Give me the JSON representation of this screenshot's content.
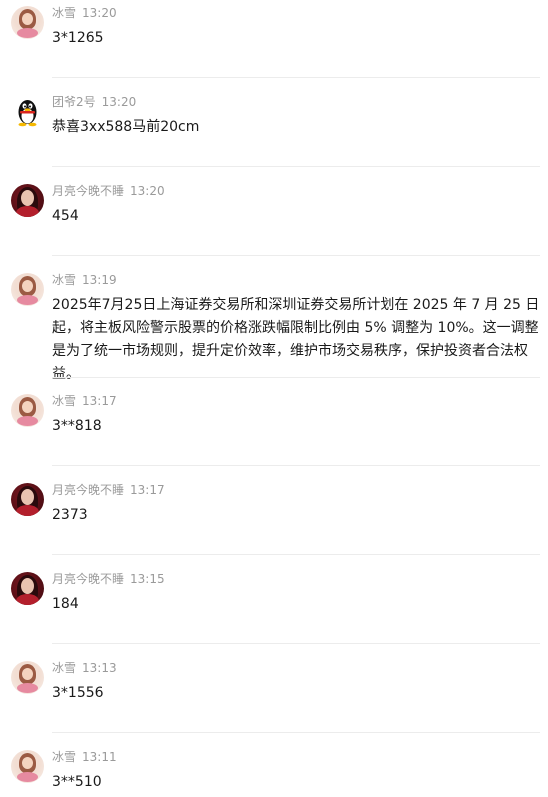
{
  "messages": [
    {
      "sender": "冰雪",
      "time": "13:20",
      "text": "3*1265",
      "avatar": "bingxue-avatar"
    },
    {
      "sender": "团爷2号",
      "time": "13:20",
      "text": "恭喜3xx588马前20cm",
      "avatar": "qq-penguin-avatar"
    },
    {
      "sender": "月亮今晚不睡",
      "time": "13:20",
      "text": "454",
      "avatar": "yueliang-avatar"
    },
    {
      "sender": "冰雪",
      "time": "13:19",
      "text": "2025年7月25日上海证券交易所和深圳证券交易所计划在 2025 年 7 月 25 日起，将主板风险警示股票的价格涨跌幅限制比例由 5% 调整为 10%。这一调整是为了统一市场规则，提升定价效率，维护市场交易秩序，保护投资者合法权益。",
      "avatar": "bingxue-avatar"
    },
    {
      "sender": "冰雪",
      "time": "13:17",
      "text": "3**818",
      "avatar": "bingxue-avatar"
    },
    {
      "sender": "月亮今晚不睡",
      "time": "13:17",
      "text": "2373",
      "avatar": "yueliang-avatar"
    },
    {
      "sender": "月亮今晚不睡",
      "time": "13:15",
      "text": "184",
      "avatar": "yueliang-avatar"
    },
    {
      "sender": "冰雪",
      "time": "13:13",
      "text": "3*1556",
      "avatar": "bingxue-avatar"
    },
    {
      "sender": "冰雪",
      "time": "13:11",
      "text": "3**510",
      "avatar": "bingxue-avatar"
    }
  ],
  "colors": {
    "meta_text": "#9a9a9a",
    "body_text": "#1a1a1a",
    "divider": "#ececec",
    "background": "#ffffff"
  }
}
